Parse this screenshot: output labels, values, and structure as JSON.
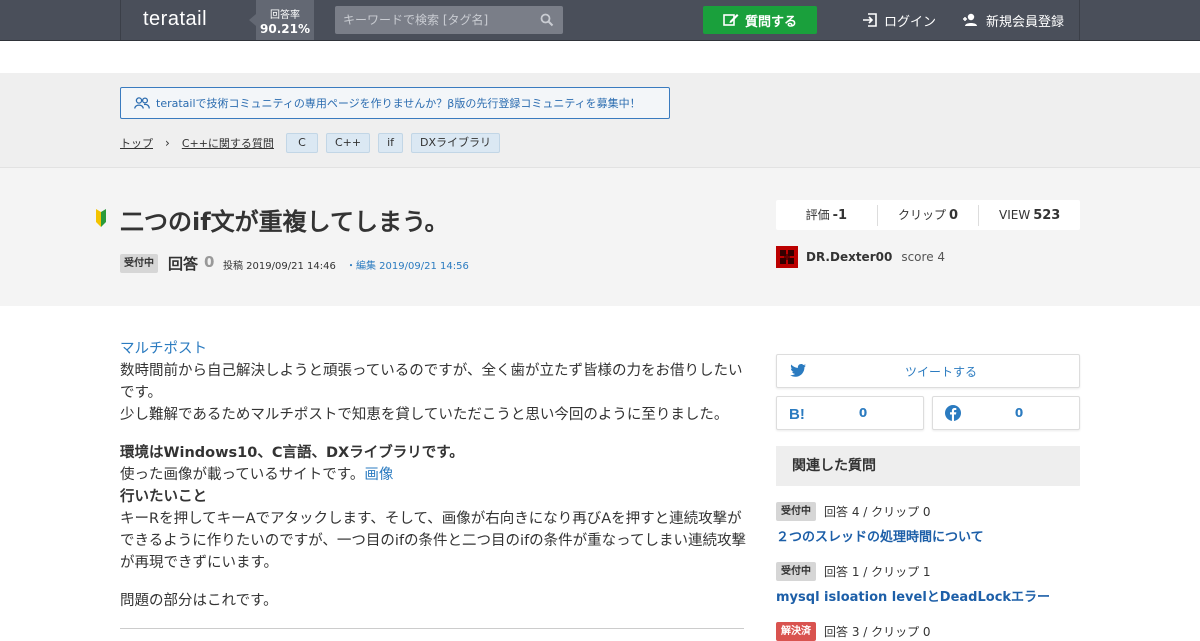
{
  "header": {
    "logo": "teratail",
    "rate_label": "回答率",
    "rate_value": "90.21%",
    "search_placeholder": "キーワードで検索 [タグ名]",
    "ask_label": "質問する",
    "login_label": "ログイン",
    "signup_label": "新規会員登録"
  },
  "community_banner": "teratailで技術コミュニティの専用ページを作りませんか？β版の先行登録コミュニティを募集中！",
  "breadcrumb": {
    "top": "トップ",
    "sep": "›",
    "category": "C++に関する質問",
    "tags": [
      "C",
      "C++",
      "if",
      "DXライブラリ"
    ]
  },
  "question": {
    "title": "二つのif文が重複してしまう。",
    "status": "受付中",
    "answer_label": "回答",
    "answer_count": "0",
    "posted": "投稿 2019/09/21 14:46",
    "edited": "・編集 2019/09/21 14:56",
    "stats": {
      "rating_label": "評価",
      "rating_value": "-1",
      "clip_label": "クリップ",
      "clip_value": "0",
      "view_label": "VIEW",
      "view_value": "523"
    },
    "author": {
      "name": "DR.Dexter00",
      "score": "score 4"
    }
  },
  "body": {
    "multipost": "マルチポスト",
    "line1": "数時間前から自己解決しようと頑張っているのですが、全く歯が立たず皆様の力をお借りしたいです。",
    "line2": "少し難解であるためマルチポストで知恵を貸していただこうと思い今回のように至りました。",
    "env": "環境はWindows10、C言語、DXライブラリです。",
    "image_site": "使った画像が載っているサイトです。",
    "image_link": "画像",
    "want_heading": "行いたいこと",
    "want_text": "キーRを押してキーAでアタックします、そして、画像が右向きになり再びAを押すと連続攻撃ができるように作りたいのですが、一つ目のifの条件と二つ目のifの条件が重なってしまい連続攻撃が再現できずにいます。",
    "problem": "問題の部分はこれです。"
  },
  "sidebar": {
    "tweet_label": "ツイートする",
    "hatena_count": "0",
    "facebook_count": "0",
    "related_heading": "関連した質問",
    "related": [
      {
        "status": "受付中",
        "meta": "回答 4 / クリップ 0",
        "title": "２つのスレッドの処理時間について"
      },
      {
        "status": "受付中",
        "meta": "回答 1 / クリップ 1",
        "title": "mysql isloation levelとDeadLockエラー"
      },
      {
        "status": "解決済",
        "meta": "回答 3 / クリップ 0",
        "title": ""
      }
    ]
  },
  "colors": {
    "header_bg": "#4a4f5a",
    "accent_green": "#1aa03c",
    "link_blue": "#2b7bc0"
  }
}
